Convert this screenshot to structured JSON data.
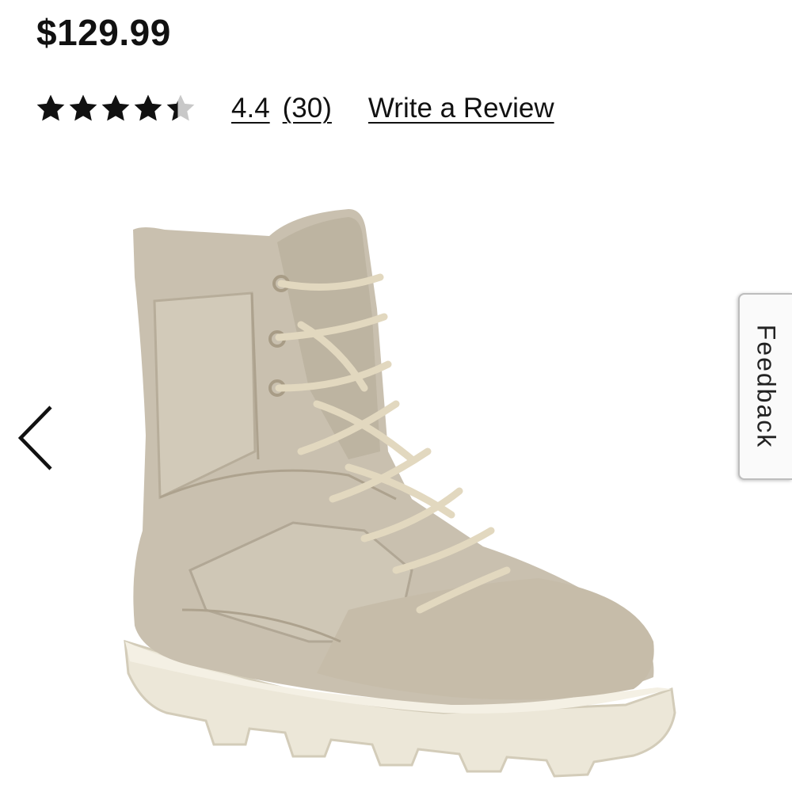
{
  "product": {
    "price": "$129.99",
    "image_alt": "Tan suede and mesh lace-up combat boot"
  },
  "rating": {
    "stars_filled": 4.4,
    "stars_total": 5,
    "value": "4.4",
    "count": "(30)",
    "write_review_label": "Write a Review"
  },
  "carousel": {
    "prev_icon": "chevron-left-icon"
  },
  "feedback": {
    "label": "Feedback"
  },
  "colors": {
    "text": "#111111",
    "star_filled": "#111111",
    "star_empty": "#c8c8c8",
    "boot_suede": "#c8bfaf",
    "sole": "#ece7d8"
  }
}
